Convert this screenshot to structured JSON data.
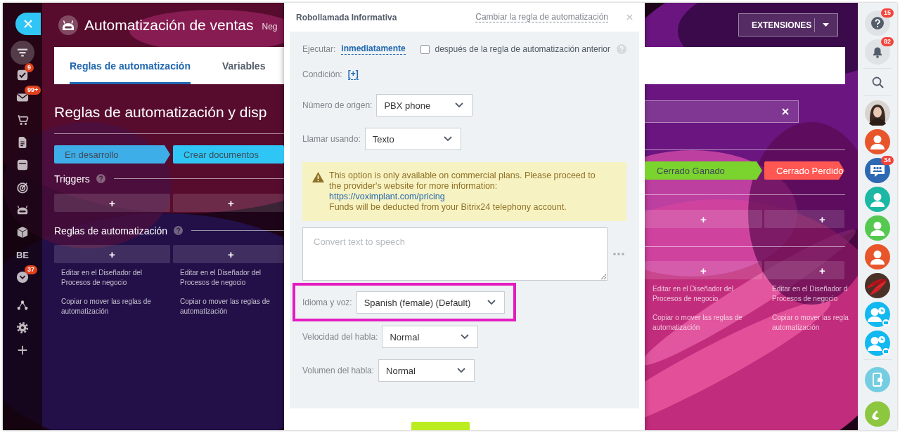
{
  "nav": {
    "items": [
      {
        "kind": "filter",
        "selected": true
      },
      {
        "kind": "tasks",
        "selected": false,
        "badge": "9"
      },
      {
        "kind": "mail",
        "selected": false,
        "badge": "99+"
      },
      {
        "kind": "cart",
        "selected": false
      },
      {
        "kind": "document",
        "selected": false
      },
      {
        "kind": "card",
        "selected": false
      },
      {
        "kind": "target",
        "selected": false
      },
      {
        "kind": "robot",
        "selected": false
      },
      {
        "kind": "box",
        "selected": false
      },
      {
        "kind": "text",
        "label": "BE",
        "selected": false
      },
      {
        "kind": "chevron",
        "selected": false,
        "badge": "37"
      },
      {
        "kind": "nodes",
        "selected": false
      },
      {
        "kind": "gear",
        "selected": false
      },
      {
        "kind": "plus",
        "selected": false
      }
    ]
  },
  "header": {
    "title": "Automatización de ventas",
    "subtitle": "Neg",
    "extensions_button": "EXTENSIONES"
  },
  "tabs": [
    {
      "label": "Reglas de automatización",
      "selected": true
    },
    {
      "label": "Variables",
      "selected": false
    }
  ],
  "page_heading": "Reglas de automatización y disp",
  "section_labels": {
    "triggers": "Triggers",
    "rules": "Reglas de automatización"
  },
  "left_columns": [
    {
      "stage": {
        "label": "En desarrollo",
        "color": "#3eaee9"
      },
      "trigger_add": "+",
      "rule_add": "+",
      "links": [
        {
          "lines": [
            "Editar en el Diseñador del",
            "Procesos de negocio"
          ]
        },
        {
          "lines": [
            "Copiar o mover las reglas de",
            "automatización"
          ]
        }
      ]
    },
    {
      "stage": {
        "label": "Crear documentos",
        "color": "#2fc6f6"
      },
      "trigger_add": "+",
      "rule_add": "+",
      "links": [
        {
          "lines": [
            "Editar en el Diseñador del",
            "Procesos de negocio"
          ]
        },
        {
          "lines": [
            "Copiar o mover las reglas de",
            "automatización"
          ]
        }
      ]
    }
  ],
  "right_columns": [
    {
      "stage": {
        "label": "Cerrado Ganado",
        "color": "#7bd32e"
      },
      "trigger_add": "+",
      "rule_add": "+",
      "links": [
        {
          "lines": [
            "Editar en el Diseñador del",
            "Procesos de negocio"
          ]
        },
        {
          "lines": [
            "Copiar o mover las reglas de",
            "automatización"
          ]
        }
      ]
    },
    {
      "stage": {
        "label": "Cerrado Perdido",
        "color": "#ff5752"
      },
      "trigger_add": "+",
      "rule_add": "+",
      "links": [
        {
          "lines": [
            "Editar en el Diseñador d",
            "Procesos de negocio"
          ]
        },
        {
          "lines": [
            "Copiar o mover las regla",
            "automatización"
          ]
        }
      ]
    }
  ],
  "slider": {
    "title": "Robollamada Informativa",
    "change_link": "Cambiar la regla de automatización",
    "execute": {
      "label": "Ejecutar:",
      "value": "inmediatamente"
    },
    "after_previous": {
      "label": "después de la regla de automatización anterior",
      "checked": false
    },
    "condition": {
      "label": "Condición:",
      "value": "[+]"
    },
    "rows": [
      {
        "kind": "select",
        "label": "Número de origen:",
        "value": "PBX phone",
        "highlighted": false
      },
      {
        "kind": "select",
        "label": "Llamar usando:",
        "value": "Texto",
        "highlighted": false
      },
      {
        "kind": "notice",
        "text": "This option is only available on commercial plans. Please proceed to the provider's website for more information:",
        "link": "https://voximplant.com/pricing",
        "note": "Funds will be deducted from your Bitrix24 telephony account."
      },
      {
        "kind": "textarea",
        "placeholder": "Convert text to speech"
      },
      {
        "kind": "select",
        "label": "Idioma y voz:",
        "value": "Spanish (female) (Default)",
        "highlighted": true
      },
      {
        "kind": "select",
        "label": "Velocidad del habla:",
        "value": "Normal",
        "highlighted": false
      },
      {
        "kind": "select",
        "label": "Volumen del habla:",
        "value": "Normal",
        "highlighted": false
      }
    ]
  },
  "rightbar": {
    "notifications": [
      {
        "kind": "help",
        "badge": "15"
      },
      {
        "kind": "bell",
        "badge": "82"
      }
    ],
    "contacts": [
      {
        "kind": "photo-woman"
      },
      {
        "kind": "user",
        "color": "#e8552b"
      },
      {
        "kind": "chat",
        "color": "#2d69b2",
        "badge": "34"
      },
      {
        "kind": "user",
        "color": "#1cb8a3"
      },
      {
        "kind": "user",
        "color": "#55c94f"
      },
      {
        "kind": "user",
        "color": "#e8552b"
      },
      {
        "kind": "photo-peppers"
      },
      {
        "kind": "user-clock",
        "color": "#12b8f0"
      },
      {
        "kind": "user-clock",
        "color": "#12b8f0"
      }
    ],
    "actions": [
      {
        "kind": "phone-cloud",
        "color": "#74cde1"
      },
      {
        "kind": "call",
        "color": "#8dc63f"
      }
    ]
  }
}
